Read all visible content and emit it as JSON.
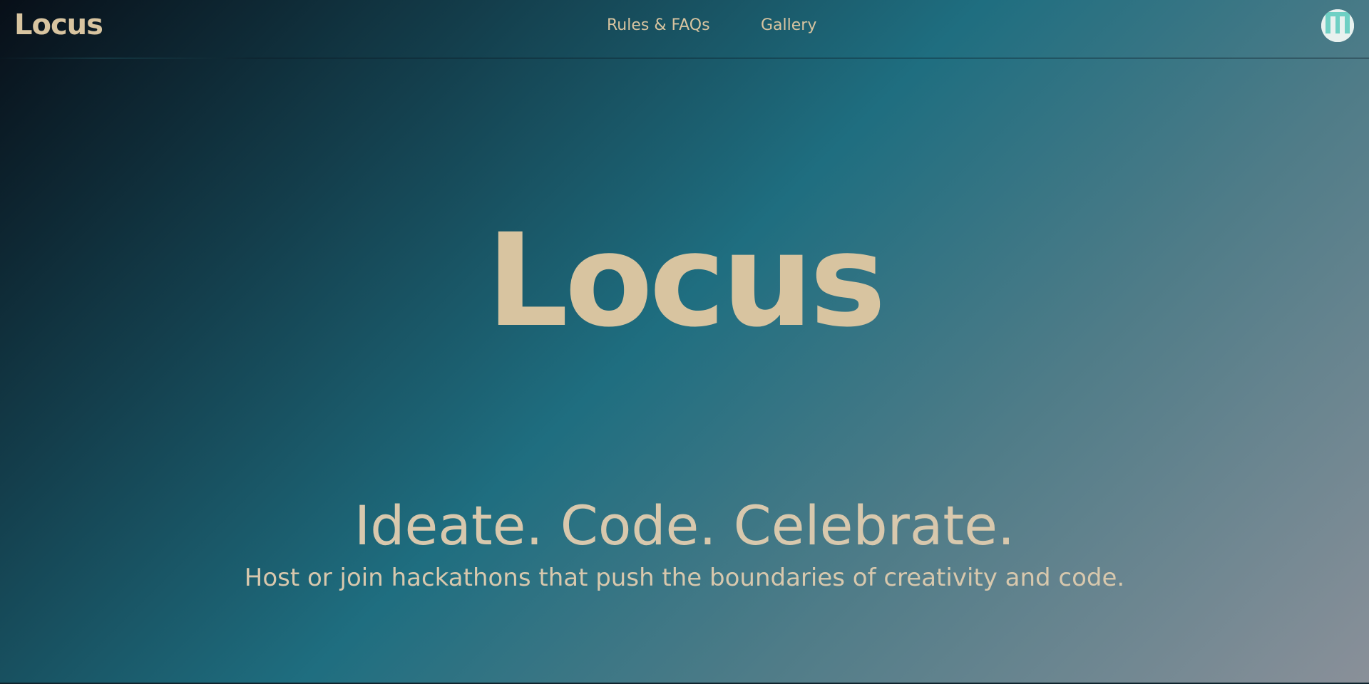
{
  "header": {
    "brand": "Locus",
    "nav": [
      {
        "label": "Rules & FAQs"
      },
      {
        "label": "Gallery"
      }
    ],
    "avatar_icon": "user-avatar-icon"
  },
  "hero": {
    "title": "Locus",
    "tagline": "Ideate. Code. Celebrate.",
    "subtitle": "Host or join hackathons that push the boundaries of creativity and code."
  },
  "colors": {
    "text": "#d8c4a0",
    "avatar_accent": "#6fd0c4",
    "gradient_start": "#080f18",
    "gradient_mid": "#1f6e80",
    "gradient_end": "#8a9099"
  }
}
